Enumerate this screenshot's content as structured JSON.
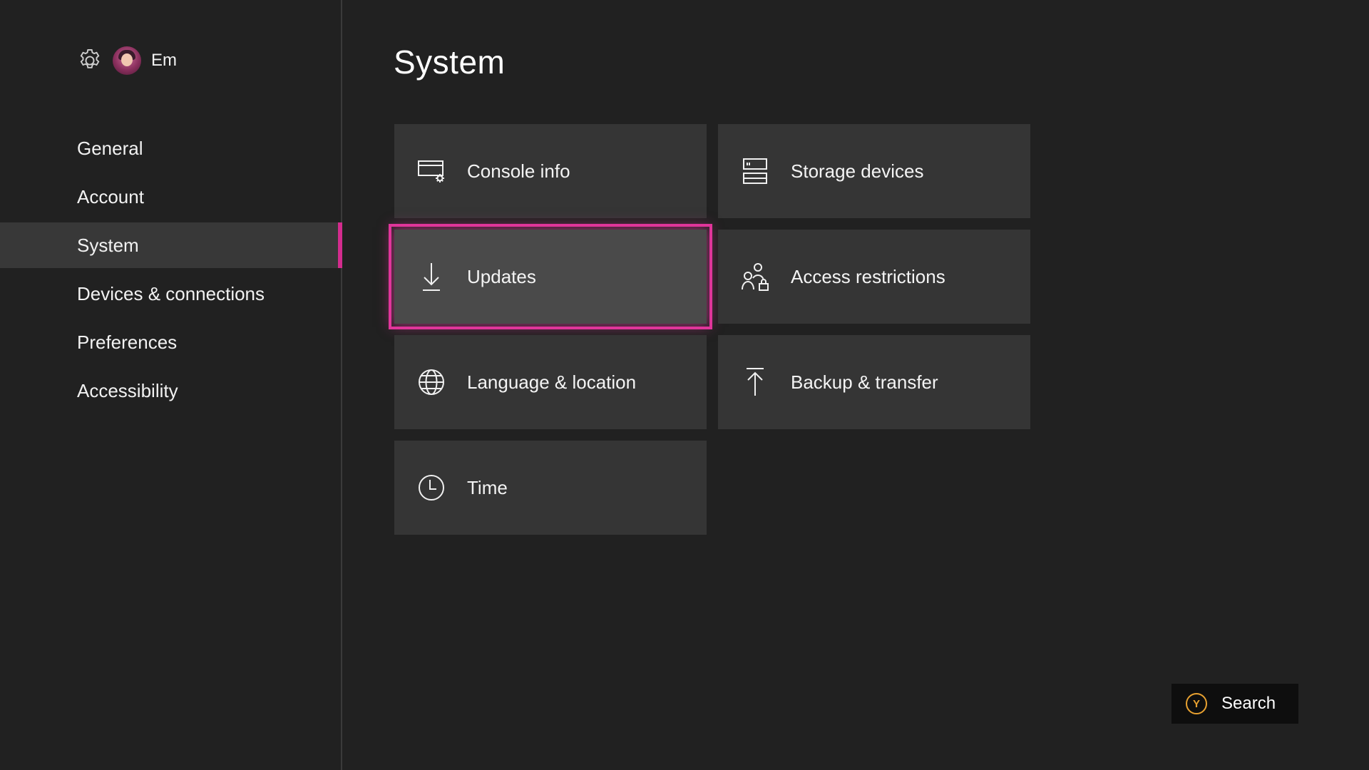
{
  "profile": {
    "settings_icon": "gear-icon",
    "username": "Em"
  },
  "nav": {
    "items": [
      {
        "label": "General",
        "active": false
      },
      {
        "label": "Account",
        "active": false
      },
      {
        "label": "System",
        "active": true
      },
      {
        "label": "Devices & connections",
        "active": false
      },
      {
        "label": "Preferences",
        "active": false
      },
      {
        "label": "Accessibility",
        "active": false
      }
    ]
  },
  "page": {
    "title": "System"
  },
  "tiles": [
    {
      "label": "Console info",
      "icon": "console-info-icon"
    },
    {
      "label": "Storage devices",
      "icon": "storage-devices-icon"
    },
    {
      "label": "Updates",
      "icon": "download-arrow-icon",
      "focused": true
    },
    {
      "label": "Access restrictions",
      "icon": "access-restrictions-icon"
    },
    {
      "label": "Language & location",
      "icon": "globe-icon"
    },
    {
      "label": "Backup & transfer",
      "icon": "upload-arrow-icon"
    },
    {
      "label": "Time",
      "icon": "clock-icon"
    }
  ],
  "search": {
    "button_glyph": "Y",
    "label": "Search"
  },
  "colors": {
    "background": "#212121",
    "tile": "#353535",
    "tile_focused": "#4a4a4a",
    "accent": "#d32c8e",
    "y_button": "#e8a130"
  }
}
